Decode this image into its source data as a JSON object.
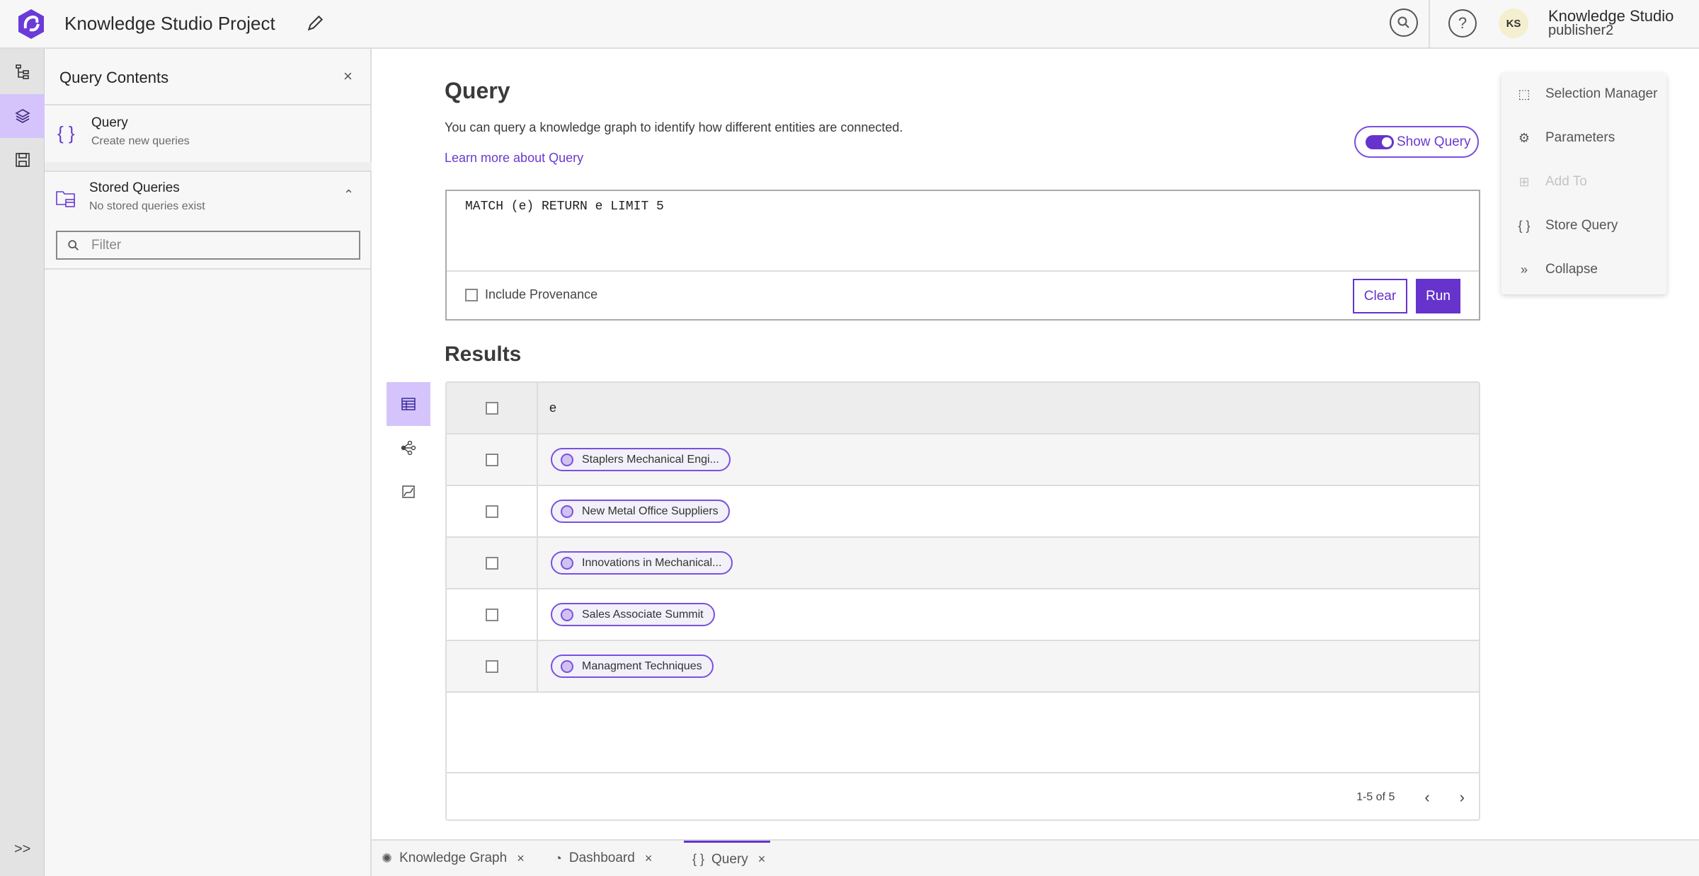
{
  "header": {
    "title": "Knowledge Studio Project",
    "user_initials": "KS",
    "user_name": "Knowledge Studio",
    "user_role": "publisher2"
  },
  "colors": {
    "accent": "#6633cc",
    "accent_light": "#d4c4fb"
  },
  "rail": {
    "items": [
      "content-tree",
      "layers",
      "save"
    ],
    "expand": ">>"
  },
  "panel": {
    "title": "Query Contents",
    "close": "×",
    "query_item": {
      "title": "Query",
      "subtitle": "Create new queries",
      "icon": "{ }"
    },
    "stored": {
      "title": "Stored Queries",
      "subtitle": "No stored queries exist"
    },
    "filter_placeholder": "Filter"
  },
  "main": {
    "title": "Query",
    "description": "You can query a knowledge graph to identify how different entities are connected.",
    "learn_more": "Learn more about Query",
    "show_query": "Show Query",
    "show_query_on": true,
    "query_text": "MATCH (e) RETURN e LIMIT 5",
    "include_provenance": "Include Provenance",
    "clear": "Clear",
    "run": "Run",
    "results_title": "Results"
  },
  "table": {
    "column": "e",
    "rows": [
      "Staplers Mechanical Engi...",
      "New Metal Office Suppliers",
      "Innovations in Mechanical...",
      "Sales Associate Summit",
      "Managment Techniques"
    ],
    "pager": "1-5 of 5",
    "prev": "‹",
    "next": "›"
  },
  "menu": {
    "items": [
      {
        "label": "Selection Manager",
        "icon": "selection-icon",
        "enabled": true
      },
      {
        "label": "Parameters",
        "icon": "gear-icon",
        "enabled": true
      },
      {
        "label": "Add To",
        "icon": "add-to-icon",
        "enabled": false
      },
      {
        "label": "Store Query",
        "icon": "braces-icon",
        "enabled": true
      },
      {
        "label": "Collapse",
        "icon": "chevrons-right-icon",
        "enabled": true
      }
    ]
  },
  "tabs": [
    {
      "label": "Knowledge Graph"
    },
    {
      "label": "Dashboard"
    },
    {
      "label": "Query",
      "active": true
    }
  ]
}
